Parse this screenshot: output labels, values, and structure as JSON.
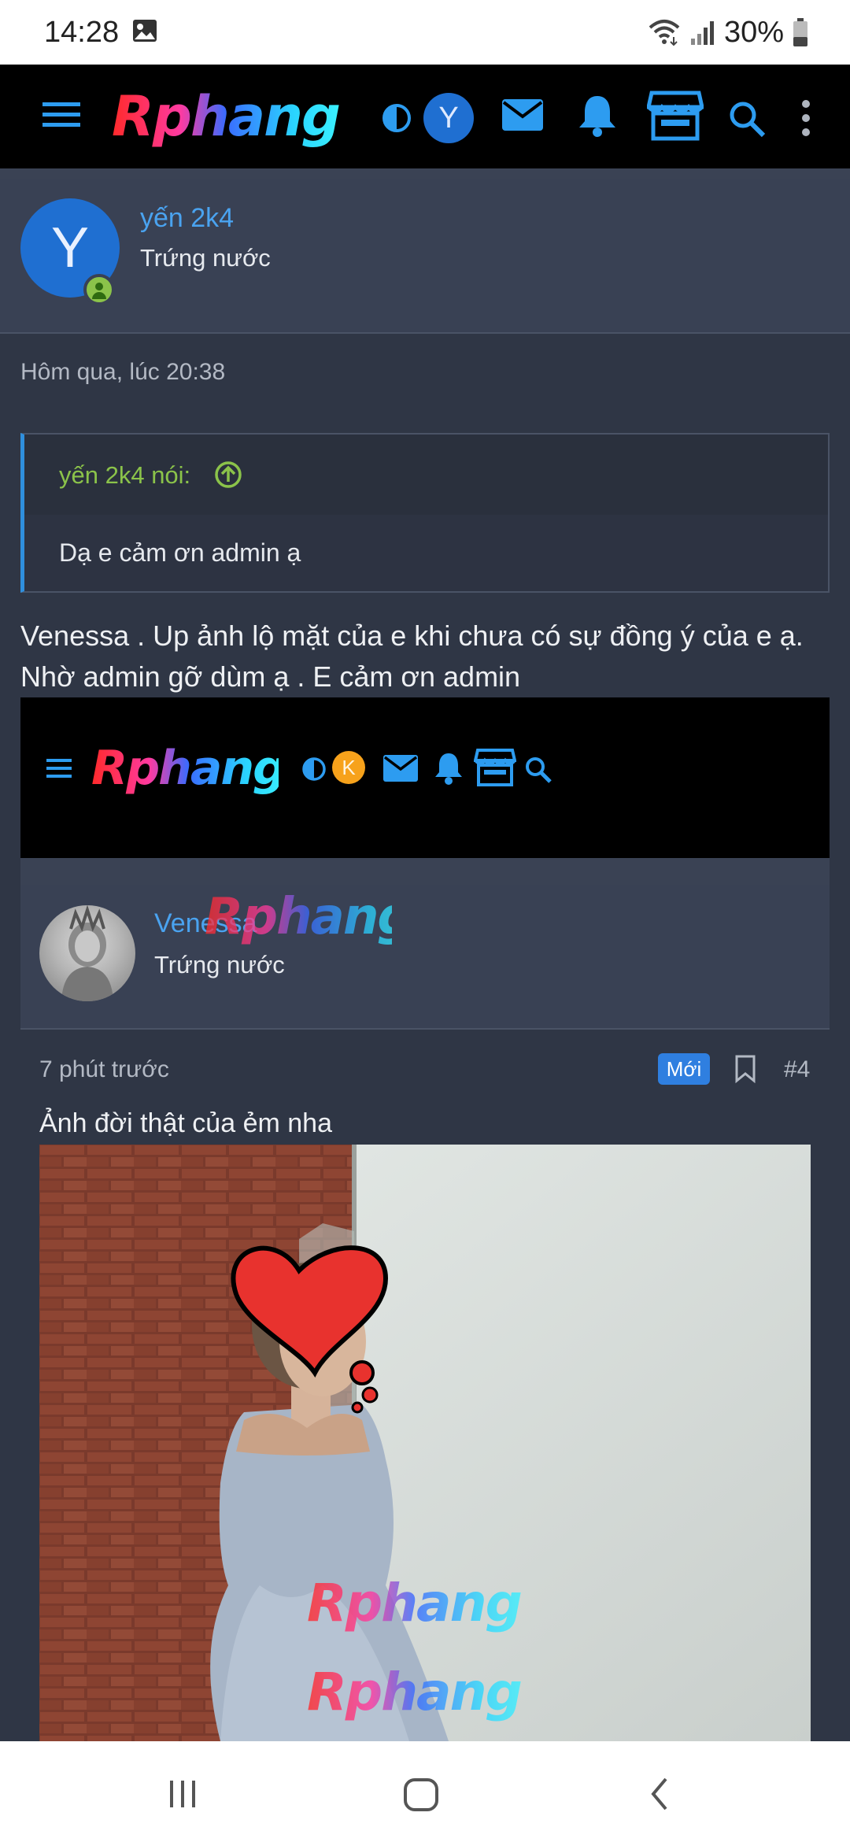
{
  "status_bar": {
    "time": "14:28",
    "battery": "30%",
    "icons": [
      "gallery-icon",
      "wifi-icon",
      "signal-icon",
      "battery-icon"
    ]
  },
  "header": {
    "logo": "Rphang",
    "avatar_letter": "Y",
    "icons": [
      "menu-icon",
      "theme-toggle-icon",
      "mail-icon",
      "bell-icon",
      "store-icon",
      "search-icon",
      "more-vert-icon"
    ],
    "accent_color": "#2d9cf0"
  },
  "post": {
    "author": {
      "avatar_letter": "Y",
      "name": "yến 2k4",
      "role": "Trứng nước",
      "avatar_color": "#1f6fd1",
      "status_color": "#8bc34a"
    },
    "time": "Hôm qua, lúc 20:38",
    "quote": {
      "author": "yến 2k4 nói:",
      "text": "Dạ e cảm ơn admin ạ"
    },
    "message_line1": "Venessa . Up ảnh lộ mặt của e khi chưa có sự đồng ý của e ạ.",
    "message_line2": "Nhờ admin gỡ dùm ạ . E cảm ơn admin"
  },
  "embedded_screenshot": {
    "header": {
      "logo": "Rphang",
      "avatar_letter": "K",
      "avatar_color": "#f7a21b"
    },
    "watermark": "Rphang",
    "author": {
      "name": "Venessa",
      "role": "Trứng nước"
    },
    "time": "7 phút trước",
    "badge": "Mới",
    "post_number": "#4",
    "text": "Ảnh đời thật của ẻm nha",
    "photo_watermarks": [
      "Rphang",
      "Rphang"
    ]
  },
  "nav_bar": {
    "icons": [
      "recent-apps-icon",
      "home-icon",
      "back-icon"
    ]
  }
}
